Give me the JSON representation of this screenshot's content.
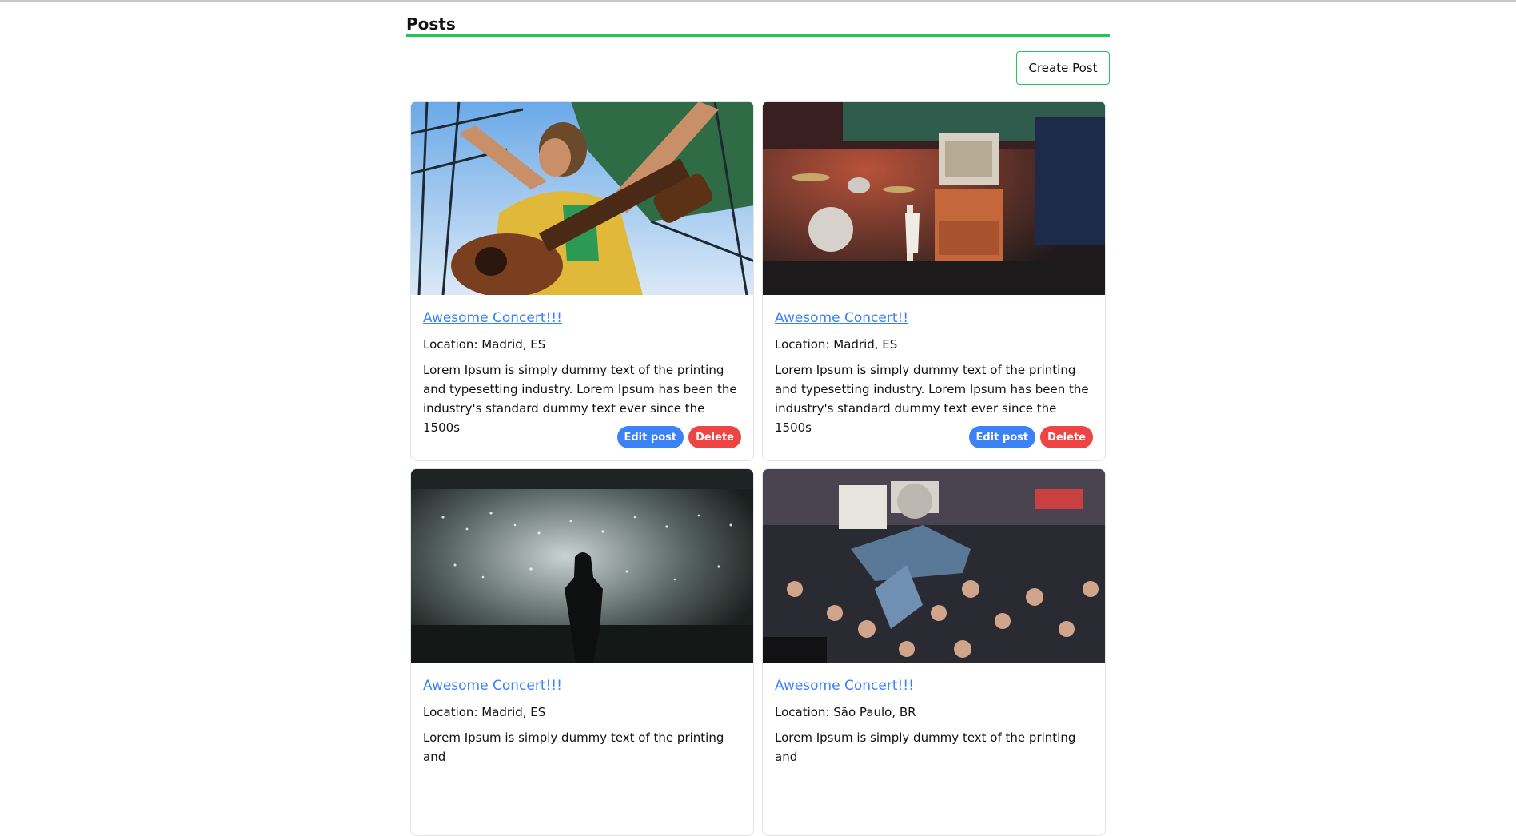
{
  "header": {
    "title": "Posts"
  },
  "toolbar": {
    "create_label": "Create Post"
  },
  "colors": {
    "accent": "#22c55e",
    "link": "#3b82f6",
    "edit": "#3b82f6",
    "delete": "#ef4444"
  },
  "posts": [
    {
      "title": "Awesome Concert!!!",
      "location": "Location: Madrid, ES",
      "description": "Lorem Ipsum is simply dummy text of the printing and typesetting industry. Lorem Ipsum has been the industry's standard dummy text ever since the 1500s",
      "image": "singer-with-guitar-photo",
      "edit_label": "Edit post",
      "delete_label": "Delete"
    },
    {
      "title": "Awesome Concert!!",
      "location": "Location: Madrid, ES",
      "description": "Lorem Ipsum is simply dummy text of the printing and typesetting industry. Lorem Ipsum has been the industry's standard dummy text ever since the 1500s",
      "image": "stage-drums-amps-photo",
      "edit_label": "Edit post",
      "delete_label": "Delete"
    },
    {
      "title": "Awesome Concert!!!",
      "location": "Location: Madrid, ES",
      "description": "Lorem Ipsum is simply dummy text of the printing and",
      "image": "arena-crowd-lights-photo"
    },
    {
      "title": "Awesome Concert!!!",
      "location": "Location: São Paulo, BR",
      "description": "Lorem Ipsum is simply dummy text of the printing and",
      "image": "crowd-surfing-photo"
    }
  ]
}
